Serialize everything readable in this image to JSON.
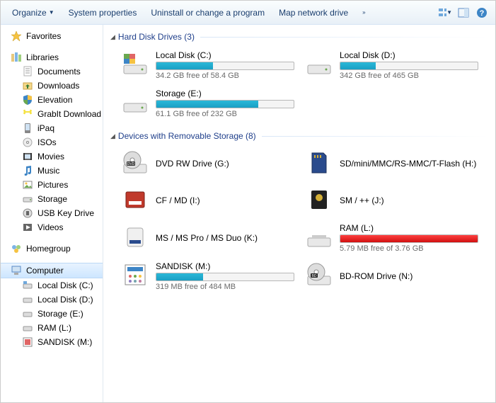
{
  "toolbar": {
    "organize": "Organize",
    "system_properties": "System properties",
    "uninstall": "Uninstall or change a program",
    "map_drive": "Map network drive"
  },
  "sidebar": {
    "favorites": {
      "label": "Favorites"
    },
    "libraries": {
      "label": "Libraries",
      "items": [
        "Documents",
        "Downloads",
        "Elevation",
        "GrabIt Download",
        "iPaq",
        "ISOs",
        "Movies",
        "Music",
        "Pictures",
        "Storage",
        "USB Key Drive",
        "Videos"
      ]
    },
    "homegroup": {
      "label": "Homegroup"
    },
    "computer": {
      "label": "Computer",
      "items": [
        "Local Disk (C:)",
        "Local Disk (D:)",
        "Storage (E:)",
        "RAM (L:)",
        "SANDISK (M:)"
      ]
    }
  },
  "groups": {
    "hdd": {
      "label": "Hard Disk Drives (3)"
    },
    "removable": {
      "label": "Devices with Removable Storage (8)"
    }
  },
  "drives": {
    "c": {
      "name": "Local Disk (C:)",
      "stat": "34.2 GB free of 58.4 GB",
      "fill": 41
    },
    "d": {
      "name": "Local Disk (D:)",
      "stat": "342 GB free of 465 GB",
      "fill": 26
    },
    "e": {
      "name": "Storage (E:)",
      "stat": "61.1 GB free of 232 GB",
      "fill": 74
    },
    "g": {
      "name": "DVD RW Drive (G:)"
    },
    "h": {
      "name": "SD/mini/MMC/RS-MMC/T-Flash (H:)"
    },
    "i": {
      "name": "CF / MD (I:)"
    },
    "j": {
      "name": "SM / ++ (J:)"
    },
    "k": {
      "name": "MS / MS Pro / MS Duo (K:)"
    },
    "l": {
      "name": "RAM (L:)",
      "stat": "5.79 MB free of 3.76 GB",
      "fill": 100,
      "warn": true
    },
    "m": {
      "name": "SANDISK (M:)",
      "stat": "319 MB free of 484 MB",
      "fill": 34
    },
    "n": {
      "name": "BD-ROM Drive (N:)"
    }
  }
}
